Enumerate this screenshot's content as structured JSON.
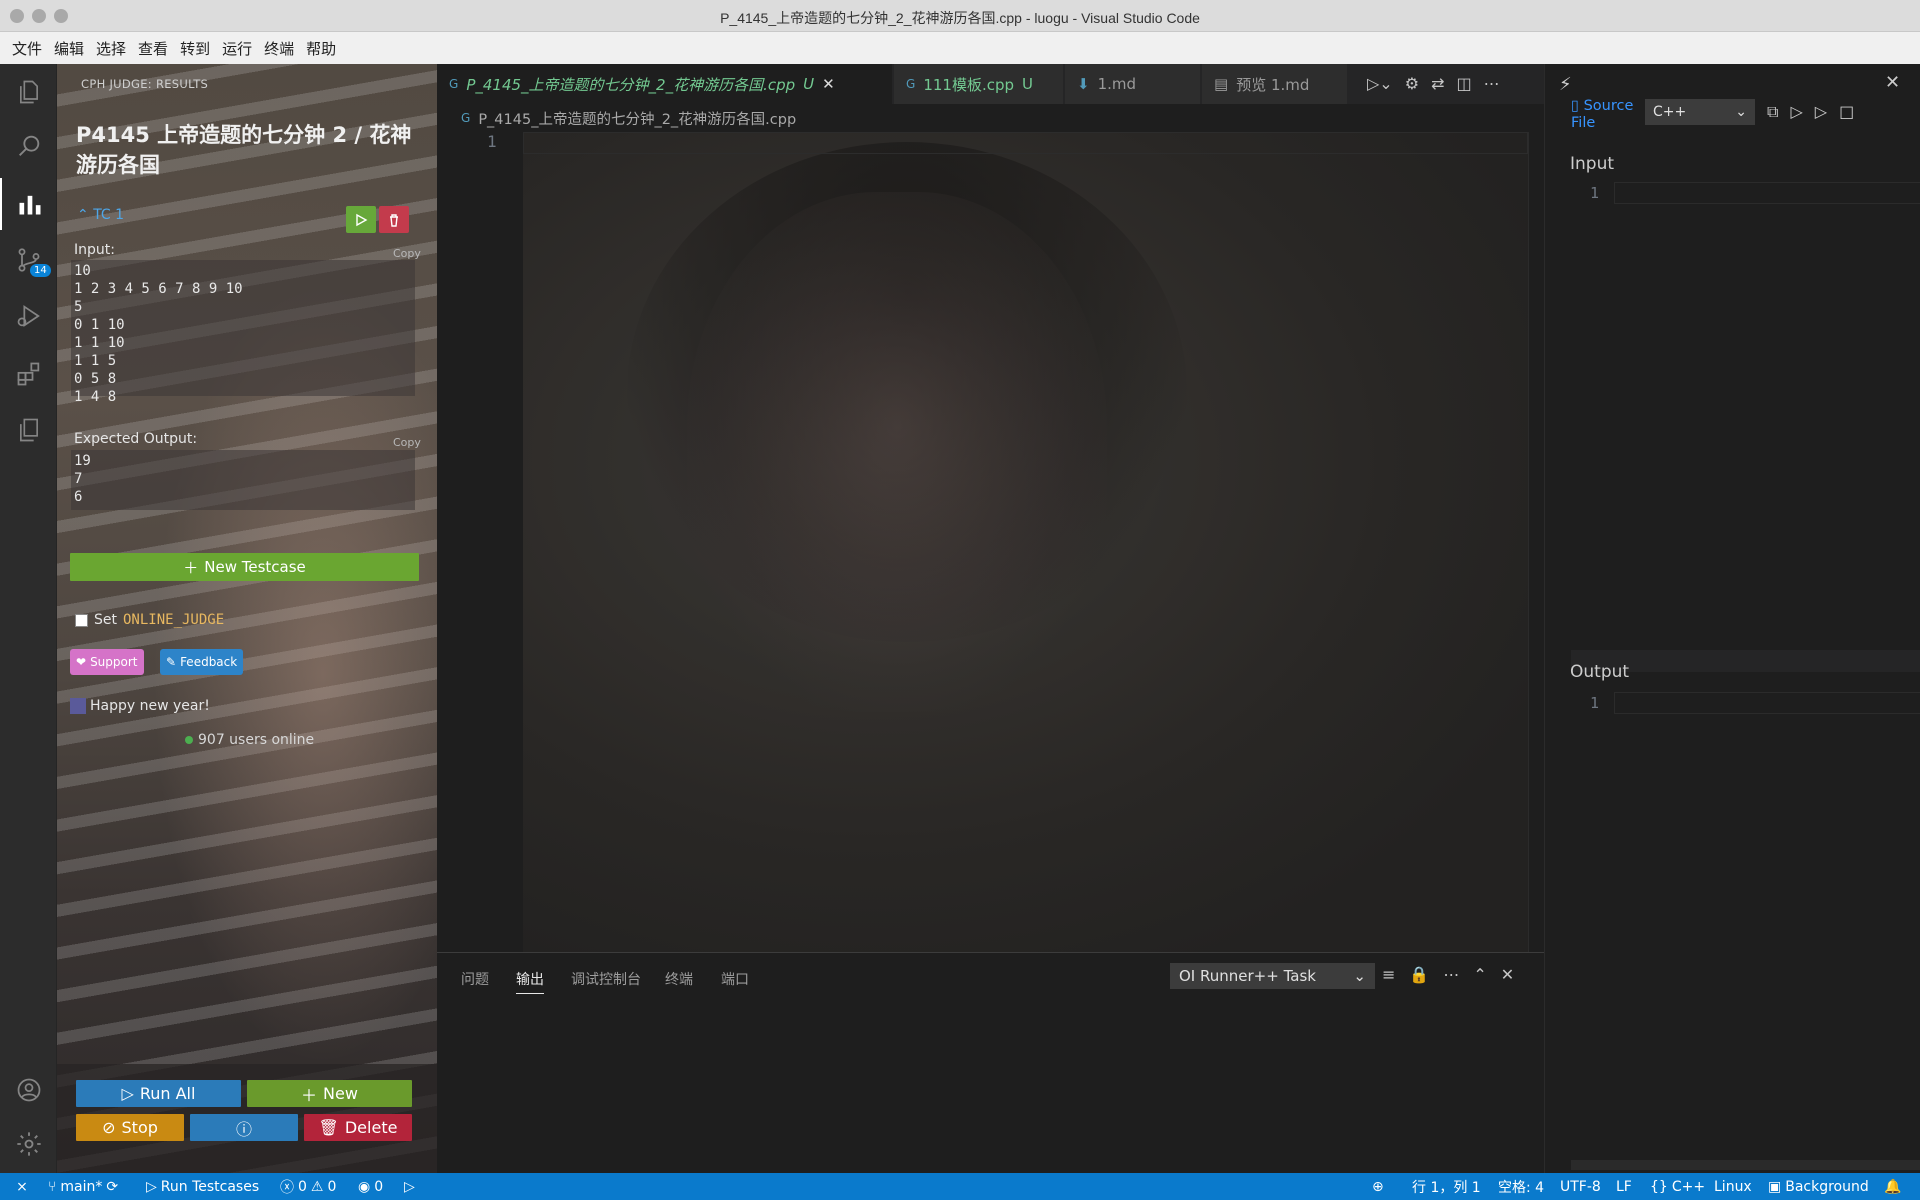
{
  "window": {
    "title": "P_4145_上帝造题的七分钟_2_花神游历各国.cpp - luogu - Visual Studio Code"
  },
  "menu": [
    "文件",
    "编辑",
    "选择",
    "查看",
    "转到",
    "运行",
    "终端",
    "帮助"
  ],
  "activity": {
    "scm_badge": "14"
  },
  "cph": {
    "header": "CPH JUDGE: RESULTS",
    "problem_title": "P4145 上帝造题的七分钟 2 / 花神游历各国",
    "testcase_label": "TC 1",
    "input_label": "Input:",
    "input_value": "10\n1 2 3 4 5 6 7 8 9 10\n5\n0 1 10\n1 1 10\n1 1 5\n0 5 8\n1 4 8",
    "expected_label": "Expected Output:",
    "expected_value": "19\n7\n6",
    "copy_label": "Copy",
    "new_testcase_label": "New Testcase",
    "set_label": "Set",
    "online_judge_label": "ONLINE_JUDGE",
    "support_label": "Support",
    "feedback_label": "Feedback",
    "greeting": "Happy new year!",
    "online_users": "907 users online",
    "run_all_label": "Run All",
    "new_label": "New",
    "stop_label": "Stop",
    "delete_label": "Delete",
    "colors": {
      "run": "#2b7bb9",
      "new": "#6a9a2c",
      "stop": "#c98a12",
      "delete": "#b3243a",
      "tc_label": "#4ea6e8",
      "run_icon": "#67a83a",
      "delete_icon": "#c33b4c"
    }
  },
  "tabs": [
    {
      "label": "P_4145_上帝造题的七分钟_2_花神游历各国.cpp",
      "status": "U",
      "active": true
    },
    {
      "label": "111模板.cpp",
      "status": "U",
      "active": false
    },
    {
      "label": "1.md",
      "status": "",
      "active": false
    },
    {
      "label": "预览 1.md",
      "status": "",
      "active": false
    }
  ],
  "breadcrumb": "P_4145_上帝造题的七分钟_2_花神游历各国.cpp",
  "editor": {
    "line_number": "1"
  },
  "panel": {
    "tabs": [
      "问题",
      "输出",
      "调试控制台",
      "终端",
      "端口"
    ],
    "active_tab": "输出",
    "channel": "OI Runner++ Task"
  },
  "right_panel": {
    "source_file_label": "Source File",
    "language": "C++",
    "input_label": "Input",
    "output_label": "Output",
    "input_line": "1",
    "output_line": "1"
  },
  "status": {
    "branch": "main*",
    "run_testcases": "Run Testcases",
    "errors": "0",
    "warnings": "0",
    "ports": "0",
    "position": "行 1，列 1",
    "spaces": "空格: 4",
    "encoding": "UTF-8",
    "eol": "LF",
    "language": "C++",
    "os": "Linux",
    "background": "Background"
  }
}
